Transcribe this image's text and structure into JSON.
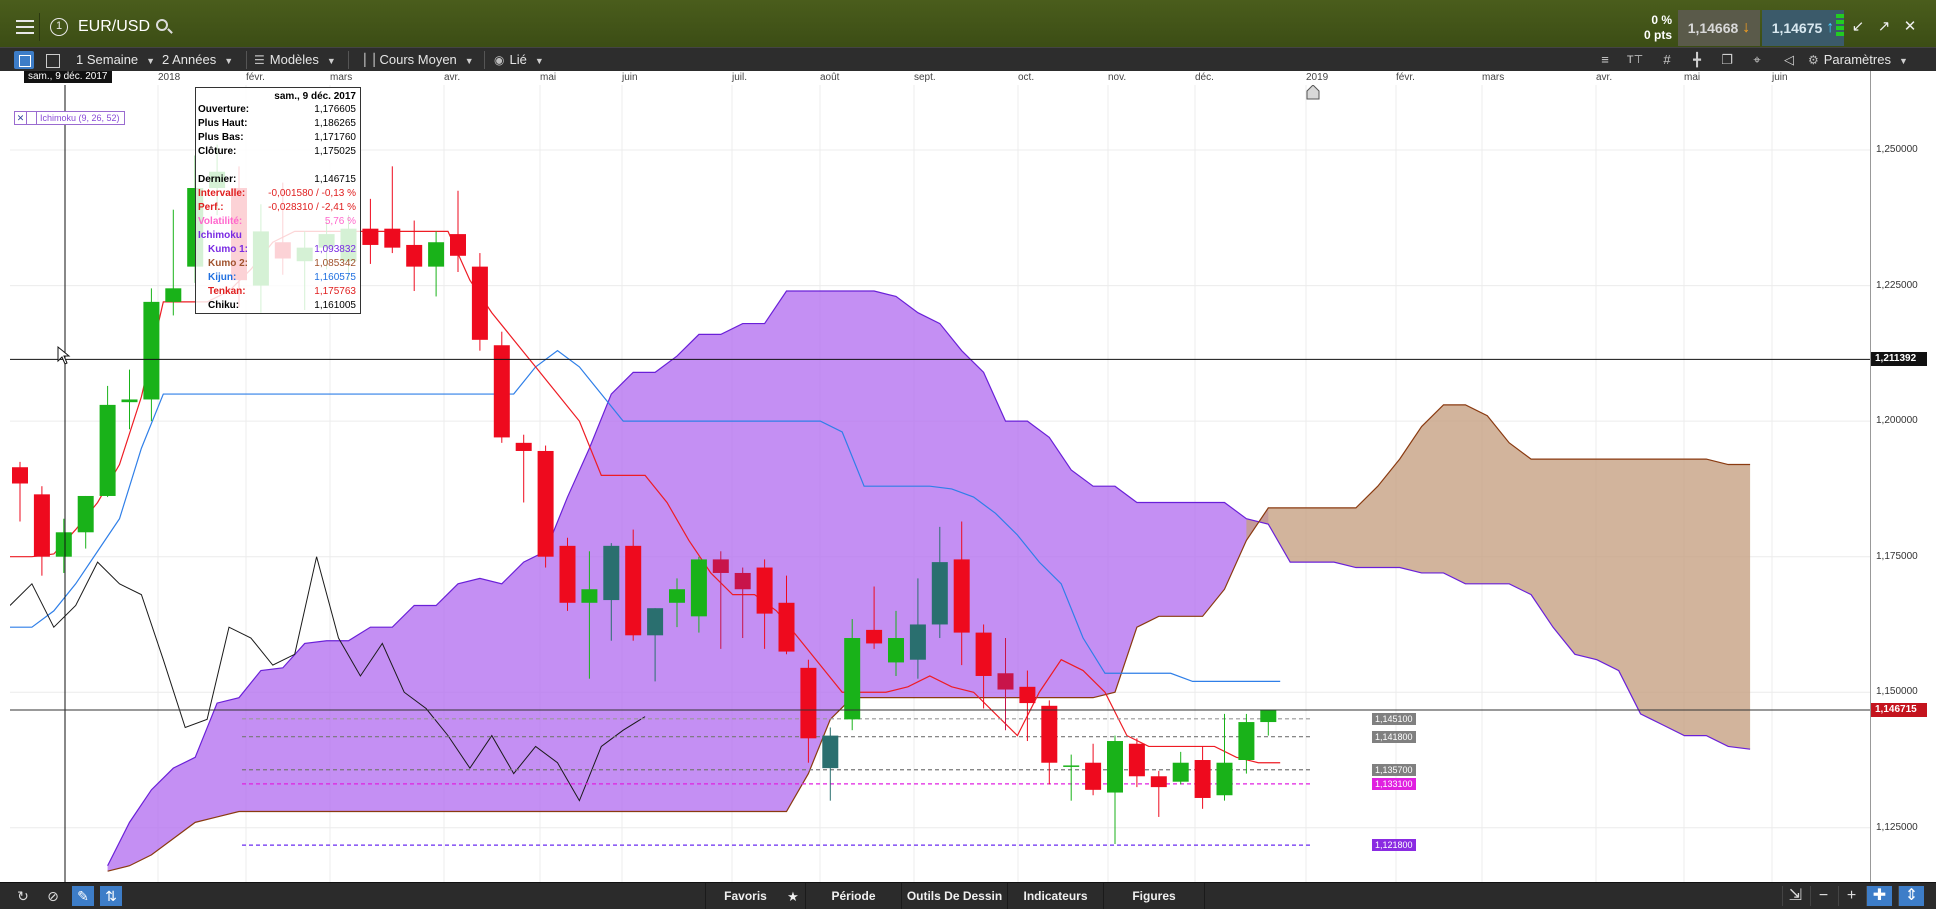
{
  "header": {
    "symbol": "EUR/USD",
    "pct_change": "0 %",
    "pts_change": "0 pts",
    "sell_price": "1,14668",
    "buy_price": "1,14675"
  },
  "toolbar": {
    "interval": "1 Semaine",
    "range": "2 Années",
    "templates": "Modèles",
    "chart_type": "Cours Moyen",
    "link": "Lié",
    "settings": "Paramètres"
  },
  "date_axis": {
    "cursor_date": "sam., 9 déc. 2017",
    "labels": [
      "2018",
      "févr.",
      "mars",
      "avr.",
      "mai",
      "juin",
      "juil.",
      "août",
      "sept.",
      "oct.",
      "nov.",
      "déc.",
      "2019",
      "févr.",
      "mars",
      "avr.",
      "mai",
      "juin"
    ]
  },
  "y_axis": {
    "ticks": [
      "1,250000",
      "1,225000",
      "1,200000",
      "1,175000",
      "1,150000",
      "1,125000"
    ],
    "crosshair_price": "1,211392",
    "last_price": "1,146715",
    "level_tags": [
      {
        "label": "1,145100",
        "color": "#808080"
      },
      {
        "label": "1,141800",
        "color": "#808080"
      },
      {
        "label": "1,135700",
        "color": "#808080"
      },
      {
        "label": "1,133100",
        "color": "#e020e0"
      },
      {
        "label": "1,121800",
        "color": "#8a2be2"
      }
    ]
  },
  "indicator_legend": {
    "label": "Ichimoku (9, 26, 52)"
  },
  "tooltip": {
    "date": "sam., 9 déc. 2017",
    "rows": [
      {
        "key": "Ouverture:",
        "value": "1,176605",
        "color": "#000000"
      },
      {
        "key": "Plus Haut:",
        "value": "1,186265",
        "color": "#000000"
      },
      {
        "key": "Plus Bas:",
        "value": "1,171760",
        "color": "#000000"
      },
      {
        "key": "Clôture:",
        "value": "1,175025",
        "color": "#000000"
      },
      {
        "key": "Dernier:",
        "value": "1,146715",
        "color": "#000000"
      },
      {
        "key": "Intervalle:",
        "value": "-0,001580 / -0,13 %",
        "color": "#e02020"
      },
      {
        "key": "Perf.:",
        "value": "-0,028310 / -2,41 %",
        "color": "#e02020"
      },
      {
        "key": "Volatilité:",
        "value": "5,76 %",
        "color": "#ff66cc"
      },
      {
        "key": "Ichimoku",
        "value": "",
        "color": "#7a2be2"
      },
      {
        "key": "Kumo 1:",
        "value": "1,093832",
        "color": "#7a2be2"
      },
      {
        "key": "Kumo 2:",
        "value": "1,085342",
        "color": "#a0522d"
      },
      {
        "key": "Kijun:",
        "value": "1,160575",
        "color": "#2070e0"
      },
      {
        "key": "Tenkan:",
        "value": "1,175763",
        "color": "#e02020"
      },
      {
        "key": "Chiku:",
        "value": "1,161005",
        "color": "#000000"
      }
    ]
  },
  "bottom_bar": {
    "tabs": [
      "Favoris",
      "Période",
      "Outils De Dessin",
      "Indicateurs",
      "Figures"
    ]
  },
  "colors": {
    "bull": "#19b219",
    "bear": "#ee0a1e",
    "bull_dark": "#2a6f6f",
    "bear_dark": "#c8144a",
    "tenkan": "#ee1c24",
    "kijun": "#2f7fe8",
    "chikou": "#1a1a1a",
    "kumo_up": "#b370f0",
    "kumo_down": "#c59f80"
  },
  "chart_data": {
    "type": "candlestick",
    "ylim": [
      1.115,
      1.262
    ],
    "candles": [
      {
        "o": 1.1915,
        "h": 1.1925,
        "l": 1.1815,
        "c": 1.1885
      },
      {
        "o": 1.1865,
        "h": 1.188,
        "l": 1.1715,
        "c": 1.175
      },
      {
        "o": 1.175,
        "h": 1.182,
        "l": 1.172,
        "c": 1.1795
      },
      {
        "o": 1.1795,
        "h": 1.1862,
        "l": 1.1765,
        "c": 1.1862
      },
      {
        "o": 1.1862,
        "h": 1.2065,
        "l": 1.186,
        "c": 1.203
      },
      {
        "o": 1.2035,
        "h": 1.2095,
        "l": 1.1985,
        "c": 1.204
      },
      {
        "o": 1.204,
        "h": 1.2245,
        "l": 1.2,
        "c": 1.222
      },
      {
        "o": 1.222,
        "h": 1.239,
        "l": 1.2195,
        "c": 1.2245
      },
      {
        "o": 1.2285,
        "h": 1.249,
        "l": 1.2255,
        "c": 1.243
      },
      {
        "o": 1.243,
        "h": 1.251,
        "l": 1.238,
        "c": 1.246
      },
      {
        "o": 1.243,
        "h": 1.247,
        "l": 1.221,
        "c": 1.226
      },
      {
        "o": 1.225,
        "h": 1.24,
        "l": 1.22,
        "c": 1.235
      },
      {
        "o": 1.233,
        "h": 1.244,
        "l": 1.227,
        "c": 1.23
      },
      {
        "o": 1.2295,
        "h": 1.235,
        "l": 1.2205,
        "c": 1.232
      },
      {
        "o": 1.232,
        "h": 1.237,
        "l": 1.228,
        "c": 1.2345
      },
      {
        "o": 1.2295,
        "h": 1.238,
        "l": 1.226,
        "c": 1.2355
      },
      {
        "o": 1.2355,
        "h": 1.241,
        "l": 1.229,
        "c": 1.2325
      },
      {
        "o": 1.2355,
        "h": 1.247,
        "l": 1.231,
        "c": 1.232
      },
      {
        "o": 1.2325,
        "h": 1.237,
        "l": 1.224,
        "c": 1.2285
      },
      {
        "o": 1.2285,
        "h": 1.235,
        "l": 1.223,
        "c": 1.233
      },
      {
        "o": 1.2345,
        "h": 1.2425,
        "l": 1.2275,
        "c": 1.2305
      },
      {
        "o": 1.2285,
        "h": 1.231,
        "l": 1.213,
        "c": 1.215
      },
      {
        "o": 1.214,
        "h": 1.2165,
        "l": 1.196,
        "c": 1.197
      },
      {
        "o": 1.196,
        "h": 1.1975,
        "l": 1.185,
        "c": 1.1945
      },
      {
        "o": 1.1945,
        "h": 1.1955,
        "l": 1.173,
        "c": 1.175
      },
      {
        "o": 1.177,
        "h": 1.1785,
        "l": 1.165,
        "c": 1.1665
      },
      {
        "o": 1.1665,
        "h": 1.176,
        "l": 1.1525,
        "c": 1.169
      },
      {
        "o": 1.167,
        "h": 1.1775,
        "l": 1.1595,
        "c": 1.177
      },
      {
        "o": 1.177,
        "h": 1.18,
        "l": 1.1595,
        "c": 1.1605
      },
      {
        "o": 1.1605,
        "h": 1.1655,
        "l": 1.152,
        "c": 1.1655
      },
      {
        "o": 1.1665,
        "h": 1.171,
        "l": 1.162,
        "c": 1.169
      },
      {
        "o": 1.164,
        "h": 1.175,
        "l": 1.161,
        "c": 1.1745
      },
      {
        "o": 1.1745,
        "h": 1.176,
        "l": 1.158,
        "c": 1.172
      },
      {
        "o": 1.172,
        "h": 1.173,
        "l": 1.16,
        "c": 1.169
      },
      {
        "o": 1.173,
        "h": 1.1745,
        "l": 1.158,
        "c": 1.1645
      },
      {
        "o": 1.1665,
        "h": 1.1715,
        "l": 1.157,
        "c": 1.1575
      },
      {
        "o": 1.1545,
        "h": 1.156,
        "l": 1.137,
        "c": 1.1415
      },
      {
        "o": 1.136,
        "h": 1.1435,
        "l": 1.13,
        "c": 1.142
      },
      {
        "o": 1.145,
        "h": 1.1635,
        "l": 1.143,
        "c": 1.16
      },
      {
        "o": 1.1615,
        "h": 1.1695,
        "l": 1.158,
        "c": 1.159
      },
      {
        "o": 1.1555,
        "h": 1.165,
        "l": 1.153,
        "c": 1.16
      },
      {
        "o": 1.156,
        "h": 1.171,
        "l": 1.1525,
        "c": 1.1625
      },
      {
        "o": 1.1625,
        "h": 1.1805,
        "l": 1.16,
        "c": 1.174
      },
      {
        "o": 1.1745,
        "h": 1.1815,
        "l": 1.155,
        "c": 1.161
      },
      {
        "o": 1.161,
        "h": 1.1625,
        "l": 1.147,
        "c": 1.153
      },
      {
        "o": 1.1535,
        "h": 1.16,
        "l": 1.143,
        "c": 1.1505
      },
      {
        "o": 1.151,
        "h": 1.154,
        "l": 1.141,
        "c": 1.148
      },
      {
        "o": 1.1475,
        "h": 1.1485,
        "l": 1.133,
        "c": 1.137
      },
      {
        "o": 1.1365,
        "h": 1.1385,
        "l": 1.13,
        "c": 1.1365
      },
      {
        "o": 1.137,
        "h": 1.1405,
        "l": 1.131,
        "c": 1.132
      },
      {
        "o": 1.1315,
        "h": 1.142,
        "l": 1.122,
        "c": 1.141
      },
      {
        "o": 1.1405,
        "h": 1.1415,
        "l": 1.1325,
        "c": 1.1345
      },
      {
        "o": 1.1345,
        "h": 1.1355,
        "l": 1.127,
        "c": 1.1325
      },
      {
        "o": 1.1335,
        "h": 1.139,
        "l": 1.133,
        "c": 1.137
      },
      {
        "o": 1.1375,
        "h": 1.14,
        "l": 1.1285,
        "c": 1.1305
      },
      {
        "o": 1.131,
        "h": 1.146,
        "l": 1.13,
        "c": 1.137
      },
      {
        "o": 1.1375,
        "h": 1.146,
        "l": 1.135,
        "c": 1.1445
      },
      {
        "o": 1.1445,
        "h": 1.1465,
        "l": 1.142,
        "c": 1.1467
      }
    ],
    "tenkan": [
      1.175,
      1.175,
      1.1755,
      1.18,
      1.185,
      1.192,
      1.2045,
      1.222,
      1.222,
      1.222,
      1.224,
      1.228,
      1.233,
      1.235,
      1.235,
      1.235,
      1.235,
      1.235,
      1.235,
      1.235,
      1.235,
      1.226,
      1.22,
      1.215,
      1.21,
      1.205,
      1.2,
      1.19,
      1.19,
      1.19,
      1.185,
      1.178,
      1.172,
      1.168,
      1.168,
      1.165,
      1.16,
      1.155,
      1.15,
      1.15,
      1.15,
      1.151,
      1.153,
      1.151,
      1.15,
      1.146,
      1.142,
      1.15,
      1.156,
      1.154,
      1.15,
      1.142,
      1.14,
      1.14,
      1.14,
      1.14,
      1.138,
      1.137,
      1.137
    ],
    "kijun": [
      1.162,
      1.162,
      1.165,
      1.17,
      1.176,
      1.182,
      1.195,
      1.205,
      1.205,
      1.205,
      1.205,
      1.205,
      1.205,
      1.205,
      1.205,
      1.205,
      1.205,
      1.205,
      1.205,
      1.205,
      1.205,
      1.205,
      1.205,
      1.205,
      1.21,
      1.213,
      1.21,
      1.205,
      1.2,
      1.2,
      1.2,
      1.2,
      1.2,
      1.2,
      1.2,
      1.2,
      1.2,
      1.2,
      1.198,
      1.188,
      1.188,
      1.188,
      1.188,
      1.1875,
      1.186,
      1.183,
      1.179,
      1.174,
      1.17,
      1.16,
      1.1535,
      1.1535,
      1.1535,
      1.1535,
      1.152,
      1.152,
      1.152,
      1.152,
      1.152
    ],
    "chikou": [
      1.166,
      1.17,
      1.162,
      1.166,
      1.174,
      1.17,
      1.168,
      1.156,
      1.1435,
      1.145,
      1.162,
      1.16,
      1.155,
      1.157,
      1.175,
      1.16,
      1.153,
      1.159,
      1.15,
      1.147,
      1.142,
      1.136,
      1.142,
      1.135,
      1.14,
      1.137,
      1.13,
      1.14,
      1.143,
      1.1455
    ],
    "kumo_a": [
      1.118,
      1.126,
      1.132,
      1.136,
      1.138,
      1.148,
      1.149,
      1.154,
      1.1545,
      1.159,
      1.1595,
      1.1595,
      1.162,
      1.162,
      1.166,
      1.166,
      1.17,
      1.171,
      1.17,
      1.174,
      1.176,
      1.186,
      1.195,
      1.205,
      1.209,
      1.209,
      1.212,
      1.216,
      1.216,
      1.218,
      1.218,
      1.224,
      1.224,
      1.224,
      1.224,
      1.224,
      1.223,
      1.22,
      1.218,
      1.213,
      1.209,
      1.2,
      1.2,
      1.197,
      1.191,
      1.188,
      1.188,
      1.185,
      1.185,
      1.185,
      1.185,
      1.185,
      1.182,
      1.181,
      1.174,
      1.174,
      1.174,
      1.173,
      1.173,
      1.173,
      1.172,
      1.172,
      1.17,
      1.17,
      1.17,
      1.168,
      1.162,
      1.157,
      1.156,
      1.154,
      1.146,
      1.144,
      1.142,
      1.142,
      1.14,
      1.1395
    ],
    "kumo_b": [
      1.117,
      1.118,
      1.12,
      1.123,
      1.126,
      1.127,
      1.128,
      1.128,
      1.128,
      1.128,
      1.128,
      1.128,
      1.128,
      1.128,
      1.128,
      1.128,
      1.128,
      1.128,
      1.128,
      1.128,
      1.128,
      1.128,
      1.128,
      1.128,
      1.128,
      1.128,
      1.128,
      1.128,
      1.128,
      1.128,
      1.128,
      1.128,
      1.135,
      1.145,
      1.149,
      1.149,
      1.149,
      1.149,
      1.149,
      1.149,
      1.149,
      1.149,
      1.149,
      1.149,
      1.149,
      1.149,
      1.15,
      1.162,
      1.164,
      1.164,
      1.164,
      1.169,
      1.178,
      1.184,
      1.184,
      1.184,
      1.184,
      1.184,
      1.188,
      1.193,
      1.199,
      1.203,
      1.203,
      1.201,
      1.196,
      1.193,
      1.193,
      1.193,
      1.193,
      1.193,
      1.193,
      1.193,
      1.193,
      1.193,
      1.192,
      1.192
    ],
    "levels": [
      {
        "y": 1.1451,
        "color": "#999999",
        "dash": "4,3"
      },
      {
        "y": 1.1418,
        "color": "#777777",
        "dash": "4,3"
      },
      {
        "y": 1.1357,
        "color": "#777777",
        "dash": "4,3"
      },
      {
        "y": 1.1331,
        "color": "#e020e0",
        "dash": "4,3"
      },
      {
        "y": 1.1218,
        "color": "#6a2bf0",
        "dash": "4,3"
      }
    ],
    "crosshair_y": 1.211392,
    "last_y": 1.146715
  }
}
